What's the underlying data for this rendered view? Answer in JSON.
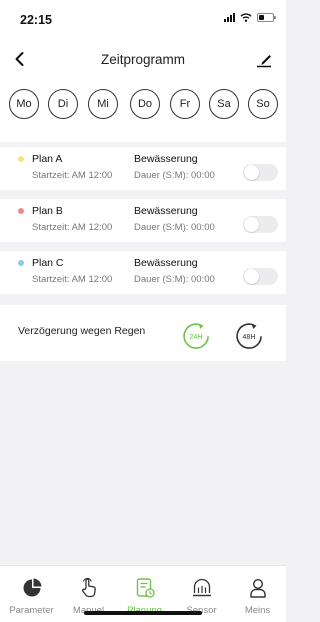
{
  "status": {
    "time": "22:15"
  },
  "nav": {
    "title": "Zeitprogramm",
    "back_icon": "chevron-left-icon",
    "edit_icon": "edit-pencil-icon"
  },
  "days": [
    "Mo",
    "Di",
    "Mi",
    "Do",
    "Fr",
    "Sa",
    "So"
  ],
  "plans": [
    {
      "name": "Plan A",
      "dot_color": "#f7e37a",
      "start": "Startzeit: AM 12:00",
      "type": "Bewässerung",
      "duration": "Dauer (S:M): 00:00",
      "enabled": false
    },
    {
      "name": "Plan B",
      "dot_color": "#f0868c",
      "start": "Startzeit: AM 12:00",
      "type": "Bewässerung",
      "duration": "Dauer (S:M): 00:00",
      "enabled": false
    },
    {
      "name": "Plan C",
      "dot_color": "#8fc6ea",
      "start": "Startzeit: AM 12:00",
      "type": "Bewässerung",
      "duration": "Dauer (S:M): 00:00",
      "enabled": false
    }
  ],
  "rain_delay": {
    "label": "Verzögerung wegen Regen",
    "options": [
      {
        "label": "24H",
        "active": true
      },
      {
        "label": "48H",
        "active": false
      }
    ]
  },
  "tabs": [
    {
      "label": "Parameter",
      "icon": "pie-chart-icon",
      "active": false
    },
    {
      "label": "Manuel",
      "icon": "hand-pointer-icon",
      "active": false
    },
    {
      "label": "Planung",
      "icon": "schedule-document-icon",
      "active": true
    },
    {
      "label": "Sensor",
      "icon": "sensor-icon",
      "active": false
    },
    {
      "label": "Meins",
      "icon": "user-icon",
      "active": false
    }
  ],
  "colors": {
    "accent": "#6cc24a",
    "background": "#f2f2f5"
  }
}
